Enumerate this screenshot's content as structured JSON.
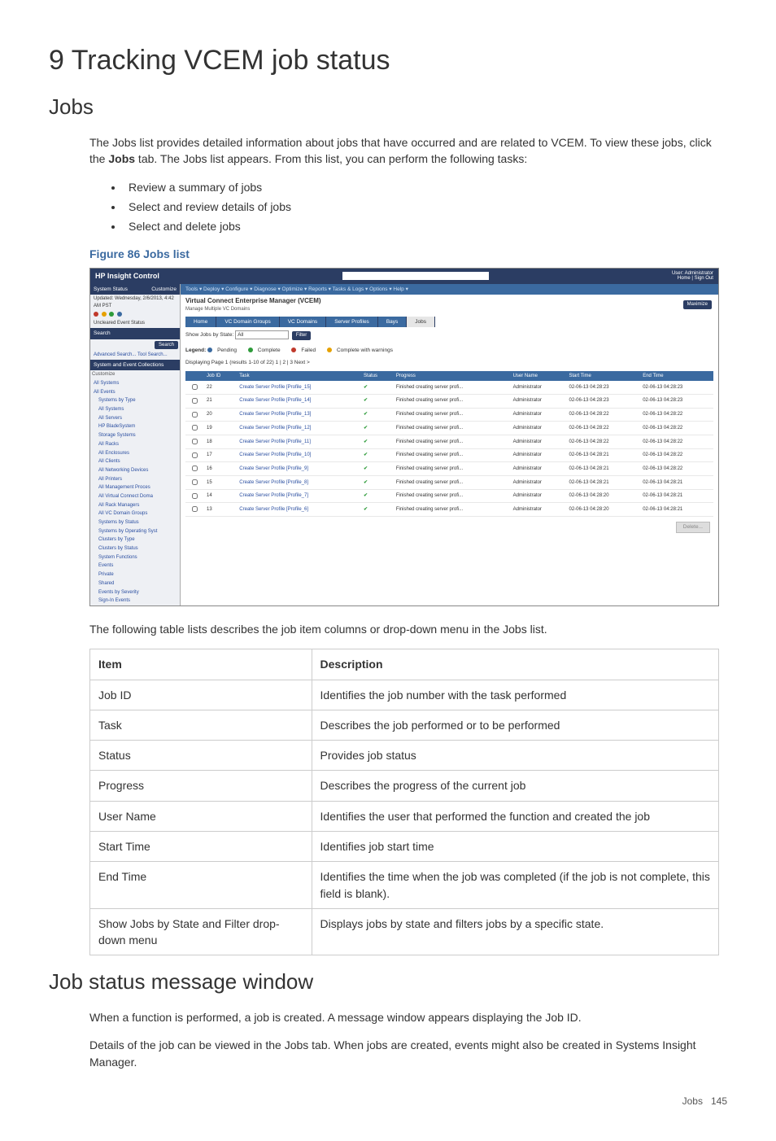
{
  "title": "9 Tracking VCEM job status",
  "section_jobs": {
    "heading": "Jobs",
    "intro": "The Jobs list provides detailed information about jobs that have occurred and are related to VCEM. To view these jobs, click the ",
    "intro_bold": "Jobs",
    "intro_after": " tab. The Jobs list appears. From this list, you can perform the following tasks:",
    "bullets": [
      "Review a summary of jobs",
      "Select and review details of jobs",
      "Select and delete jobs"
    ],
    "figure_caption": "Figure 86 Jobs list",
    "post_fig": "The following table lists describes the job item columns or drop-down menu in the Jobs list."
  },
  "screenshot": {
    "brand": "HP Insight Control",
    "user_line1": "User: Administrator",
    "user_line2": "Home | Sign Out",
    "left": {
      "hdr_status": "System Status",
      "customize": "Customize",
      "updated": "Updated: Wednesday, 2/6/2013, 4:42 AM PST",
      "uncleared": "Uncleared Event Status",
      "hdr_search": "Search",
      "btn_search": "Search",
      "adv_search": "Advanced Search...",
      "tool_search": "Tool Search...",
      "hdr_collections": "System and Event Collections",
      "all_systems": "All Systems",
      "all_events": "All Events",
      "tree": [
        "Systems by Type",
        "All Systems",
        "All Servers",
        "HP BladeSystem",
        "Storage Systems",
        "All Racks",
        "All Enclosures",
        "All Clients",
        "All Networking Devices",
        "All Printers",
        "All Management Proces",
        "All Virtual Connect Doma",
        "All Rack Managers",
        "All VC Domain Groups",
        "Systems by Status",
        "Systems by Operating Syst",
        "Clusters by Type",
        "Clusters by Status",
        "System Functions",
        "Events",
        "Private",
        "Shared",
        "Events by Severity",
        "Sign-In Events"
      ]
    },
    "menus": "Tools ▾    Deploy ▾    Configure ▾    Diagnose ▾    Optimize ▾    Reports ▾    Tasks & Logs ▾    Options ▾    Help ▾",
    "page_title": "Virtual Connect Enterprise Manager (VCEM)",
    "page_sub": "Manage Multiple VC Domains",
    "maximize": "Maximize",
    "tabs": [
      "Home",
      "VC Domain Groups",
      "VC Domains",
      "Server Profiles",
      "Bays",
      "Jobs"
    ],
    "active_tab": 5,
    "filter_label": "Show Jobs by State:",
    "filter_value": "All",
    "filter_btn": "Filter",
    "legend_label": "Legend:",
    "legend": [
      "Pending",
      "Complete",
      "Failed",
      "Complete with warnings"
    ],
    "pager": "Displaying Page 1 (results 1-10 of 22)    1 | 2 | 3   Next >",
    "cols": [
      "",
      "Job ID",
      "Task",
      "Status",
      "Progress",
      "User Name",
      "Start Time",
      "End Time"
    ],
    "rows": [
      {
        "id": "22",
        "task": "Create Server Profile [Profile_15]",
        "prog": "Finished creating server profi...",
        "user": "Administrator",
        "start": "02-06-13 04:28:23",
        "end": "02-06-13 04:28:23"
      },
      {
        "id": "21",
        "task": "Create Server Profile [Profile_14]",
        "prog": "Finished creating server profi...",
        "user": "Administrator",
        "start": "02-06-13 04:28:23",
        "end": "02-06-13 04:28:23"
      },
      {
        "id": "20",
        "task": "Create Server Profile [Profile_13]",
        "prog": "Finished creating server profi...",
        "user": "Administrator",
        "start": "02-06-13 04:28:22",
        "end": "02-06-13 04:28:22"
      },
      {
        "id": "19",
        "task": "Create Server Profile [Profile_12]",
        "prog": "Finished creating server profi...",
        "user": "Administrator",
        "start": "02-06-13 04:28:22",
        "end": "02-06-13 04:28:22"
      },
      {
        "id": "18",
        "task": "Create Server Profile [Profile_11]",
        "prog": "Finished creating server profi...",
        "user": "Administrator",
        "start": "02-06-13 04:28:22",
        "end": "02-06-13 04:28:22"
      },
      {
        "id": "17",
        "task": "Create Server Profile [Profile_10]",
        "prog": "Finished creating server profi...",
        "user": "Administrator",
        "start": "02-06-13 04:28:21",
        "end": "02-06-13 04:28:22"
      },
      {
        "id": "16",
        "task": "Create Server Profile [Profile_9]",
        "prog": "Finished creating server profi...",
        "user": "Administrator",
        "start": "02-06-13 04:28:21",
        "end": "02-06-13 04:28:22"
      },
      {
        "id": "15",
        "task": "Create Server Profile [Profile_8]",
        "prog": "Finished creating server profi...",
        "user": "Administrator",
        "start": "02-06-13 04:28:21",
        "end": "02-06-13 04:28:21"
      },
      {
        "id": "14",
        "task": "Create Server Profile [Profile_7]",
        "prog": "Finished creating server profi...",
        "user": "Administrator",
        "start": "02-06-13 04:28:20",
        "end": "02-06-13 04:28:21"
      },
      {
        "id": "13",
        "task": "Create Server Profile [Profile_6]",
        "prog": "Finished creating server profi...",
        "user": "Administrator",
        "start": "02-06-13 04:28:20",
        "end": "02-06-13 04:28:21"
      }
    ],
    "delete_btn": "Delete..."
  },
  "doc_table": {
    "h_item": "Item",
    "h_desc": "Description",
    "rows": [
      {
        "item": "Job ID",
        "desc": "Identifies the job number with the task performed"
      },
      {
        "item": "Task",
        "desc": "Describes the job performed or to be performed"
      },
      {
        "item": "Status",
        "desc": "Provides job status"
      },
      {
        "item": "Progress",
        "desc": "Describes the progress of the current job"
      },
      {
        "item": "User Name",
        "desc": "Identifies the user that performed the function and created the job"
      },
      {
        "item": "Start Time",
        "desc": "Identifies job start time"
      },
      {
        "item": "End Time",
        "desc": "Identifies the time when the job was completed (if the job is not complete, this field is blank)."
      },
      {
        "item": "Show Jobs by State and Filter drop-down menu",
        "desc": "Displays jobs by state and filters jobs by a specific state."
      }
    ]
  },
  "section_status": {
    "heading": "Job status message window",
    "p1": "When a function is performed, a job is created. A message window appears displaying the Job ID.",
    "p2": "Details of the job can be viewed in the Jobs tab. When jobs are created, events might also be created in Systems Insight Manager."
  },
  "footer": {
    "label": "Jobs",
    "page": "145"
  }
}
